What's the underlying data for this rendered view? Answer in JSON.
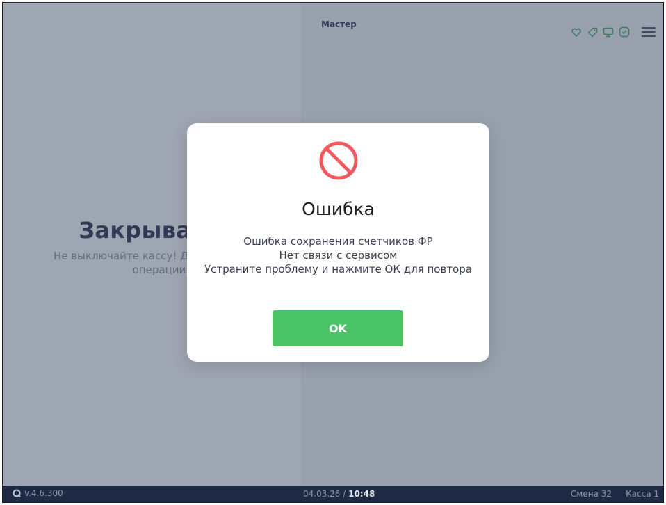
{
  "header": {
    "master_label": "Мастер",
    "icons": [
      "heart-icon",
      "tag-icon",
      "monitor-icon",
      "checklist-icon",
      "menu-icon"
    ],
    "icon_color": "#3aa356"
  },
  "main": {
    "closing_title": "Закрываем",
    "closing_subtitle": "Не выключайте кассу! До завершения операции"
  },
  "dialog": {
    "title": "Ошибка",
    "messages": [
      "Ошибка сохранения счетчиков ФР",
      "Нет связи с сервисом",
      "Устраните проблему и нажмите ОК для повтора"
    ],
    "ok_label": "OK",
    "icon": "prohibited-icon",
    "icon_color": "#f05a5f",
    "ok_color": "#49c366"
  },
  "statusbar": {
    "version": "v.4.6.300",
    "date": "04.03.26 / ",
    "time": "10:48",
    "shift": "Смена 32",
    "register": "Касса 1"
  }
}
